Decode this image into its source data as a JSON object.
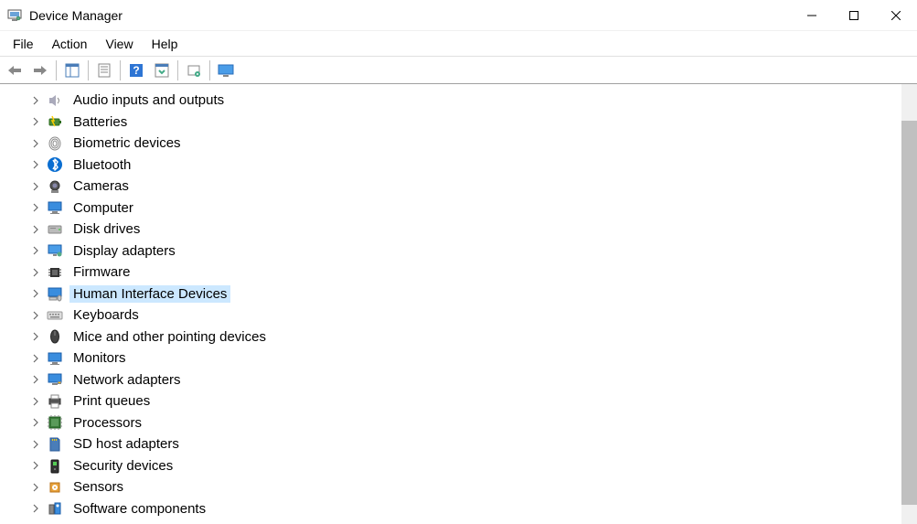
{
  "window": {
    "title": "Device Manager"
  },
  "menu": {
    "items": [
      {
        "label": "File"
      },
      {
        "label": "Action"
      },
      {
        "label": "View"
      },
      {
        "label": "Help"
      }
    ]
  },
  "toolbar": {
    "buttons": [
      {
        "name": "back",
        "icon": "arrow-left"
      },
      {
        "name": "forward",
        "icon": "arrow-right"
      },
      {
        "name": "show-hide",
        "icon": "window-panes"
      },
      {
        "name": "properties",
        "icon": "properties-list"
      },
      {
        "name": "help",
        "icon": "help-blue"
      },
      {
        "name": "update-driver",
        "icon": "update-grid"
      },
      {
        "name": "uninstall",
        "icon": "device-star"
      },
      {
        "name": "scan-hardware",
        "icon": "monitor-scan"
      }
    ]
  },
  "tree": {
    "selected_index": 9,
    "items": [
      {
        "label": "Audio inputs and outputs",
        "icon": "speaker"
      },
      {
        "label": "Batteries",
        "icon": "battery"
      },
      {
        "label": "Biometric devices",
        "icon": "fingerprint"
      },
      {
        "label": "Bluetooth",
        "icon": "bluetooth"
      },
      {
        "label": "Cameras",
        "icon": "camera"
      },
      {
        "label": "Computer",
        "icon": "monitor"
      },
      {
        "label": "Disk drives",
        "icon": "disk"
      },
      {
        "label": "Display adapters",
        "icon": "display"
      },
      {
        "label": "Firmware",
        "icon": "chip"
      },
      {
        "label": "Human Interface Devices",
        "icon": "hid"
      },
      {
        "label": "Keyboards",
        "icon": "keyboard"
      },
      {
        "label": "Mice and other pointing devices",
        "icon": "mouse"
      },
      {
        "label": "Monitors",
        "icon": "monitor"
      },
      {
        "label": "Network adapters",
        "icon": "network"
      },
      {
        "label": "Print queues",
        "icon": "printer"
      },
      {
        "label": "Processors",
        "icon": "cpu"
      },
      {
        "label": "SD host adapters",
        "icon": "sdcard"
      },
      {
        "label": "Security devices",
        "icon": "security"
      },
      {
        "label": "Sensors",
        "icon": "sensor"
      },
      {
        "label": "Software components",
        "icon": "software"
      }
    ]
  }
}
